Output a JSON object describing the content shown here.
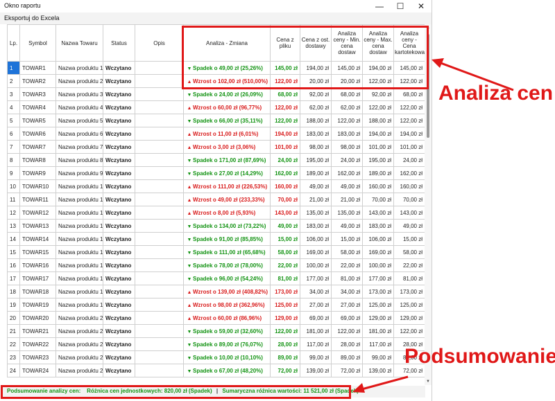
{
  "window": {
    "title": "Okno raportu"
  },
  "menu": {
    "export_label": "Eksportuj do Excela"
  },
  "colors": {
    "accent_red": "#e01818",
    "spadek_green": "#139313",
    "wzrost_red": "#d81a1a",
    "selection_blue": "#1e73d8"
  },
  "icons": {
    "up": "triangle-up-icon",
    "down": "triangle-down-icon"
  },
  "columns": [
    "Lp.",
    "Symbol",
    "Nazwa Towaru",
    "Status",
    "Opis",
    "Analiza - Zmiana",
    "Cena z pliku",
    "Cena z ost. dostawy",
    "Analiza ceny - Min. cena dostaw",
    "Analiza ceny - Max. cena dostaw",
    "Analiza ceny - Cena kartotekowa"
  ],
  "rows": [
    {
      "lp": "1",
      "symbol": "TOWAR1",
      "name": "Nazwa produktu 1",
      "status": "Wczytano",
      "opis": "",
      "dir": "spadek",
      "change": "Spadek o 49,00 zł (25,26%)",
      "cena": "145,00 zł",
      "ost": "194,00 zł",
      "min": "145,00 zł",
      "max": "194,00 zł",
      "kart": "145,00 zł"
    },
    {
      "lp": "2",
      "symbol": "TOWAR2",
      "name": "Nazwa produktu 2",
      "status": "Wczytano",
      "opis": "",
      "dir": "wzrost",
      "change": "Wzrost o 102,00 zł (510,00%)",
      "cena": "122,00 zł",
      "ost": "20,00 zł",
      "min": "20,00 zł",
      "max": "122,00 zł",
      "kart": "122,00 zł"
    },
    {
      "lp": "3",
      "symbol": "TOWAR3",
      "name": "Nazwa produktu 3",
      "status": "Wczytano",
      "opis": "",
      "dir": "spadek",
      "change": "Spadek o 24,00 zł (26,09%)",
      "cena": "68,00 zł",
      "ost": "92,00 zł",
      "min": "68,00 zł",
      "max": "92,00 zł",
      "kart": "68,00 zł"
    },
    {
      "lp": "4",
      "symbol": "TOWAR4",
      "name": "Nazwa produktu 4",
      "status": "Wczytano",
      "opis": "",
      "dir": "wzrost",
      "change": "Wzrost o 60,00 zł (96,77%)",
      "cena": "122,00 zł",
      "ost": "62,00 zł",
      "min": "62,00 zł",
      "max": "122,00 zł",
      "kart": "122,00 zł"
    },
    {
      "lp": "5",
      "symbol": "TOWAR5",
      "name": "Nazwa produktu 5",
      "status": "Wczytano",
      "opis": "",
      "dir": "spadek",
      "change": "Spadek o 66,00 zł (35,11%)",
      "cena": "122,00 zł",
      "ost": "188,00 zł",
      "min": "122,00 zł",
      "max": "188,00 zł",
      "kart": "122,00 zł"
    },
    {
      "lp": "6",
      "symbol": "TOWAR6",
      "name": "Nazwa produktu 6",
      "status": "Wczytano",
      "opis": "",
      "dir": "wzrost",
      "change": "Wzrost o 11,00 zł (6,01%)",
      "cena": "194,00 zł",
      "ost": "183,00 zł",
      "min": "183,00 zł",
      "max": "194,00 zł",
      "kart": "194,00 zł"
    },
    {
      "lp": "7",
      "symbol": "TOWAR7",
      "name": "Nazwa produktu 7",
      "status": "Wczytano",
      "opis": "",
      "dir": "wzrost",
      "change": "Wzrost o 3,00 zł (3,06%)",
      "cena": "101,00 zł",
      "ost": "98,00 zł",
      "min": "98,00 zł",
      "max": "101,00 zł",
      "kart": "101,00 zł"
    },
    {
      "lp": "8",
      "symbol": "TOWAR8",
      "name": "Nazwa produktu 8",
      "status": "Wczytano",
      "opis": "",
      "dir": "spadek",
      "change": "Spadek o 171,00 zł (87,69%)",
      "cena": "24,00 zł",
      "ost": "195,00 zł",
      "min": "24,00 zł",
      "max": "195,00 zł",
      "kart": "24,00 zł"
    },
    {
      "lp": "9",
      "symbol": "TOWAR9",
      "name": "Nazwa produktu 9",
      "status": "Wczytano",
      "opis": "",
      "dir": "spadek",
      "change": "Spadek o 27,00 zł (14,29%)",
      "cena": "162,00 zł",
      "ost": "189,00 zł",
      "min": "162,00 zł",
      "max": "189,00 zł",
      "kart": "162,00 zł"
    },
    {
      "lp": "10",
      "symbol": "TOWAR10",
      "name": "Nazwa produktu 10",
      "status": "Wczytano",
      "opis": "",
      "dir": "wzrost",
      "change": "Wzrost o 111,00 zł (226,53%)",
      "cena": "160,00 zł",
      "ost": "49,00 zł",
      "min": "49,00 zł",
      "max": "160,00 zł",
      "kart": "160,00 zł"
    },
    {
      "lp": "11",
      "symbol": "TOWAR11",
      "name": "Nazwa produktu 11",
      "status": "Wczytano",
      "opis": "",
      "dir": "wzrost",
      "change": "Wzrost o 49,00 zł (233,33%)",
      "cena": "70,00 zł",
      "ost": "21,00 zł",
      "min": "21,00 zł",
      "max": "70,00 zł",
      "kart": "70,00 zł"
    },
    {
      "lp": "12",
      "symbol": "TOWAR12",
      "name": "Nazwa produktu 12",
      "status": "Wczytano",
      "opis": "",
      "dir": "wzrost",
      "change": "Wzrost o 8,00 zł (5,93%)",
      "cena": "143,00 zł",
      "ost": "135,00 zł",
      "min": "135,00 zł",
      "max": "143,00 zł",
      "kart": "143,00 zł"
    },
    {
      "lp": "13",
      "symbol": "TOWAR13",
      "name": "Nazwa produktu 13",
      "status": "Wczytano",
      "opis": "",
      "dir": "spadek",
      "change": "Spadek o 134,00 zł (73,22%)",
      "cena": "49,00 zł",
      "ost": "183,00 zł",
      "min": "49,00 zł",
      "max": "183,00 zł",
      "kart": "49,00 zł"
    },
    {
      "lp": "14",
      "symbol": "TOWAR14",
      "name": "Nazwa produktu 14",
      "status": "Wczytano",
      "opis": "",
      "dir": "spadek",
      "change": "Spadek o 91,00 zł (85,85%)",
      "cena": "15,00 zł",
      "ost": "106,00 zł",
      "min": "15,00 zł",
      "max": "106,00 zł",
      "kart": "15,00 zł"
    },
    {
      "lp": "15",
      "symbol": "TOWAR15",
      "name": "Nazwa produktu 15",
      "status": "Wczytano",
      "opis": "",
      "dir": "spadek",
      "change": "Spadek o 111,00 zł (65,68%)",
      "cena": "58,00 zł",
      "ost": "169,00 zł",
      "min": "58,00 zł",
      "max": "169,00 zł",
      "kart": "58,00 zł"
    },
    {
      "lp": "16",
      "symbol": "TOWAR16",
      "name": "Nazwa produktu 16",
      "status": "Wczytano",
      "opis": "",
      "dir": "spadek",
      "change": "Spadek o 78,00 zł (78,00%)",
      "cena": "22,00 zł",
      "ost": "100,00 zł",
      "min": "22,00 zł",
      "max": "100,00 zł",
      "kart": "22,00 zł"
    },
    {
      "lp": "17",
      "symbol": "TOWAR17",
      "name": "Nazwa produktu 17",
      "status": "Wczytano",
      "opis": "",
      "dir": "spadek",
      "change": "Spadek o 96,00 zł (54,24%)",
      "cena": "81,00 zł",
      "ost": "177,00 zł",
      "min": "81,00 zł",
      "max": "177,00 zł",
      "kart": "81,00 zł"
    },
    {
      "lp": "18",
      "symbol": "TOWAR18",
      "name": "Nazwa produktu 18",
      "status": "Wczytano",
      "opis": "",
      "dir": "wzrost",
      "change": "Wzrost o 139,00 zł (408,82%)",
      "cena": "173,00 zł",
      "ost": "34,00 zł",
      "min": "34,00 zł",
      "max": "173,00 zł",
      "kart": "173,00 zł"
    },
    {
      "lp": "19",
      "symbol": "TOWAR19",
      "name": "Nazwa produktu 19",
      "status": "Wczytano",
      "opis": "",
      "dir": "wzrost",
      "change": "Wzrost o 98,00 zł (362,96%)",
      "cena": "125,00 zł",
      "ost": "27,00 zł",
      "min": "27,00 zł",
      "max": "125,00 zł",
      "kart": "125,00 zł"
    },
    {
      "lp": "20",
      "symbol": "TOWAR20",
      "name": "Nazwa produktu 20",
      "status": "Wczytano",
      "opis": "",
      "dir": "wzrost",
      "change": "Wzrost o 60,00 zł (86,96%)",
      "cena": "129,00 zł",
      "ost": "69,00 zł",
      "min": "69,00 zł",
      "max": "129,00 zł",
      "kart": "129,00 zł"
    },
    {
      "lp": "21",
      "symbol": "TOWAR21",
      "name": "Nazwa produktu 21",
      "status": "Wczytano",
      "opis": "",
      "dir": "spadek",
      "change": "Spadek o 59,00 zł (32,60%)",
      "cena": "122,00 zł",
      "ost": "181,00 zł",
      "min": "122,00 zł",
      "max": "181,00 zł",
      "kart": "122,00 zł"
    },
    {
      "lp": "22",
      "symbol": "TOWAR22",
      "name": "Nazwa produktu 22",
      "status": "Wczytano",
      "opis": "",
      "dir": "spadek",
      "change": "Spadek o 89,00 zł (76,07%)",
      "cena": "28,00 zł",
      "ost": "117,00 zł",
      "min": "28,00 zł",
      "max": "117,00 zł",
      "kart": "28,00 zł"
    },
    {
      "lp": "23",
      "symbol": "TOWAR23",
      "name": "Nazwa produktu 23",
      "status": "Wczytano",
      "opis": "",
      "dir": "spadek",
      "change": "Spadek o 10,00 zł (10,10%)",
      "cena": "89,00 zł",
      "ost": "99,00 zł",
      "min": "89,00 zł",
      "max": "99,00 zł",
      "kart": "89,00 zł"
    },
    {
      "lp": "24",
      "symbol": "TOWAR24",
      "name": "Nazwa produktu 24",
      "status": "Wczytano",
      "opis": "",
      "dir": "spadek",
      "change": "Spadek o 67,00 zł (48,20%)",
      "cena": "72,00 zł",
      "ost": "139,00 zł",
      "min": "72,00 zł",
      "max": "139,00 zł",
      "kart": "72,00 zł"
    }
  ],
  "summary": {
    "label": "Podsumowanie analizy cen:",
    "unit_diff": "Różnica cen jednostkowych: 820,00 zł (Spadek)",
    "separator": "|",
    "total_diff": "Sumaryczna różnica wartości: 11 521,00 zł (Spadek)"
  },
  "annotations": {
    "price_analysis": "Analiza cen",
    "summary": "Podsumowanie"
  }
}
